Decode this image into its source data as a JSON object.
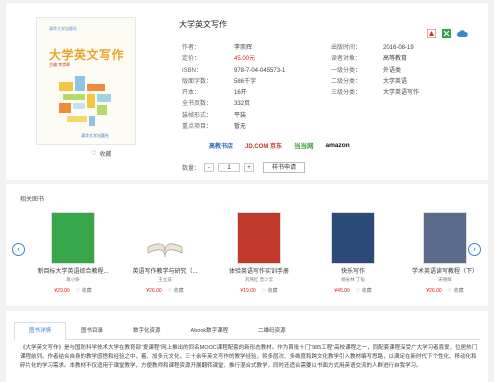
{
  "book": {
    "title": "大学英文写作",
    "cover": {
      "publisher_logo": "清华大学出版社",
      "title": "大学英文写作",
      "subtitle": "主编 李崇辉",
      "publisher": "清华大学出版社"
    },
    "favorite_label": "收藏",
    "left_meta": [
      {
        "k": "作者：",
        "v": "李崇辉"
      },
      {
        "k": "定价：",
        "v": "45.00元"
      },
      {
        "k": "ISBN：",
        "v": "978-7-04-045573-1"
      },
      {
        "k": "版面字数：",
        "v": "586千字"
      },
      {
        "k": "开本：",
        "v": "16开"
      },
      {
        "k": "全书页数：",
        "v": "332页"
      },
      {
        "k": "装帧形式：",
        "v": "平装"
      },
      {
        "k": "重点项目：",
        "v": "暂无"
      }
    ],
    "right_meta": [
      {
        "k": "出版时间：",
        "v": "2016-08-19"
      },
      {
        "k": "读者对象：",
        "v": "高等教育"
      },
      {
        "k": "一级分类：",
        "v": "外语类"
      },
      {
        "k": "二级分类：",
        "v": "大学英语"
      },
      {
        "k": "三级分类：",
        "v": "大学英语写作"
      }
    ],
    "stores": [
      "高教书店",
      "JD.COM 京东",
      "当当网",
      "amazon"
    ],
    "qty_label": "数量：",
    "qty_minus": "-",
    "qty_value": "1",
    "qty_plus": "+",
    "request_label": "样书申请"
  },
  "related": {
    "title": "相关图书",
    "prev": "‹",
    "next": "›",
    "items": [
      {
        "name": "新目标大学英语综合教程...",
        "author": "蒋小妍",
        "price": "¥29.00",
        "fav": "收藏",
        "color": "#37a64a"
      },
      {
        "name": "英语写作教学与研究（...",
        "author": "王立非",
        "price": "¥26.00",
        "fav": "收藏",
        "color": "#ffffff"
      },
      {
        "name": "体验英语写作实训手册",
        "author": "刘燕红  曾少云",
        "price": "¥19.00",
        "fav": "收藏",
        "color": "#c0392b"
      },
      {
        "name": "快乐写作",
        "author": "杨永林  丁韬",
        "price": "¥45.00",
        "fav": "收藏",
        "color": "#2b4a78"
      },
      {
        "name": "学术英语读写教程（下）",
        "author": "宋德辉",
        "price": "¥26.00",
        "fav": "收藏",
        "color": "#5b6b8a"
      }
    ]
  },
  "detail": {
    "tabs": [
      "图书详情",
      "图书目录",
      "数字化资源",
      "Abook数字课程",
      "二维码资源"
    ],
    "description": "《大学英文写作》是与国防科学技术大学在教育部“爱课程”网上推出的同名MOOC课程配套的新形态教材。作为首批十门“985工程”高校课程之一，同配套课程深受广大学习者喜爱，位居热门课程前列。作者结合自身的教学感悟和经验之中，着、加多元文化，三十余年英文写作的教学经验，将多层次、多维度和跨文化教学引入教材编写思路，以满足在新时代下个性化、移动化和碎片化的学习需求。本教材不仅适用于课堂教学，方便教师和课程资源开展翻转课堂、推行混合式教学，同时还适合需要以书面方式用英语交流的人群进行自我学习。"
  },
  "colors": {
    "accent": "#3a86c8",
    "price": "#e02020"
  }
}
